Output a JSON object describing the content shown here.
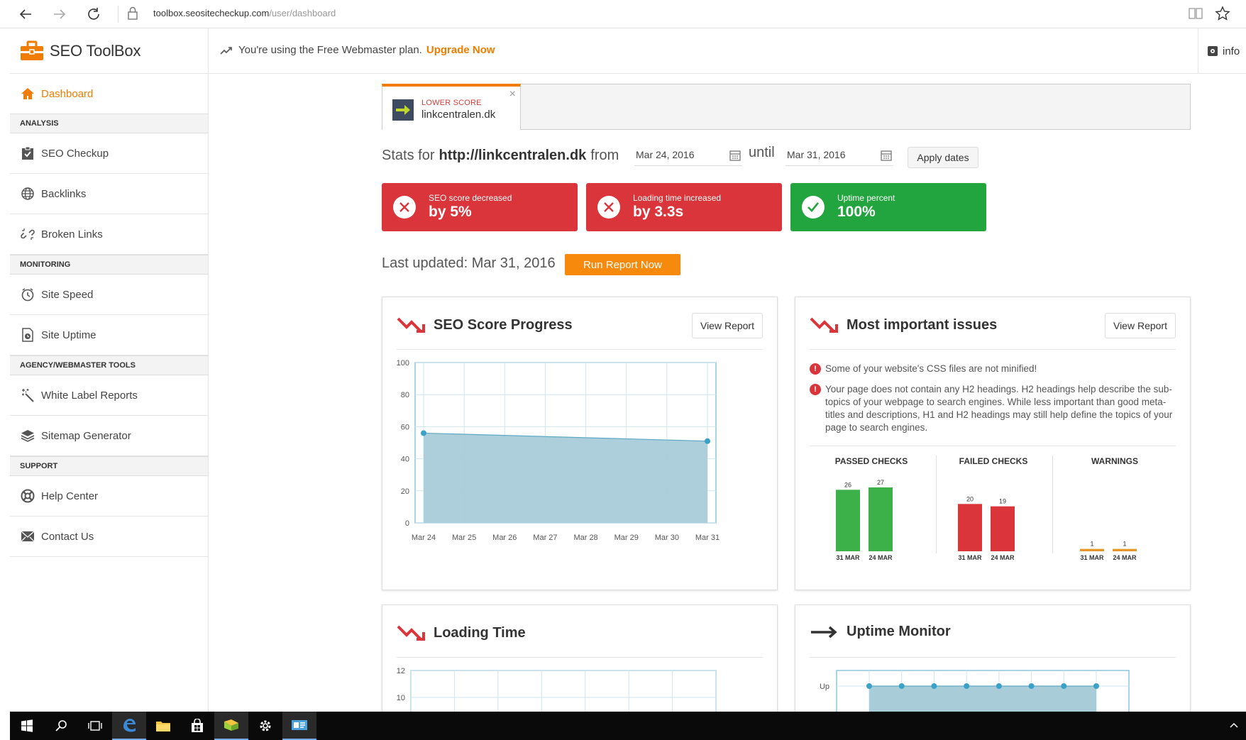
{
  "browser": {
    "url_host": "toolbox.seositecheckup.com",
    "url_path": "/user/dashboard"
  },
  "header": {
    "brand": "SEO ToolBox",
    "plan_text": "You're using the Free Webmaster plan.",
    "upgrade_label": "Upgrade Now",
    "info_label": "info"
  },
  "sidebar": {
    "dashboard": "Dashboard",
    "sections": {
      "analysis": "ANALYSIS",
      "monitoring": "MONITORING",
      "agency": "AGENCY/WEBMASTER TOOLS",
      "support": "SUPPORT"
    },
    "items": {
      "seo_checkup": "SEO Checkup",
      "backlinks": "Backlinks",
      "broken_links": "Broken Links",
      "site_speed": "Site Speed",
      "site_uptime": "Site Uptime",
      "white_label": "White Label Reports",
      "sitemap": "Sitemap Generator",
      "help": "Help Center",
      "contact": "Contact Us"
    }
  },
  "tab": {
    "status": "LOWER SCORE",
    "domain": "linkcentralen.dk",
    "close": "×"
  },
  "stats": {
    "prefix": "Stats for",
    "site": "http://linkcentralen.dk",
    "from": "from",
    "from_date": "Mar 24, 2016",
    "until": "until",
    "until_date": "Mar 31, 2016",
    "apply": "Apply dates"
  },
  "alerts": [
    {
      "small": "SEO score decreased",
      "big": "by 5%"
    },
    {
      "small": "Loading time increased",
      "big": "by 3.3s"
    },
    {
      "small": "Uptime percent",
      "big": "100%"
    }
  ],
  "last_updated": "Last updated: Mar 31, 2016",
  "run_report": "Run Report Now",
  "panels": {
    "seo_progress": {
      "title": "SEO Score Progress",
      "button": "View Report"
    },
    "issues": {
      "title": "Most important issues",
      "button": "View Report",
      "items": [
        "Some of your website's CSS files are not minified!",
        "Your page does not contain any H2 headings. H2 headings help describe the sub-topics of your webpage to search engines. While less important than good meta-titles and descriptions, H1 and H2 headings may still help define the topics of your page to search engines."
      ],
      "passed": "PASSED CHECKS",
      "failed": "FAILED CHECKS",
      "warnings": "WARNINGS",
      "issue_icon": "!"
    },
    "loading": {
      "title": "Loading Time"
    },
    "uptime": {
      "title": "Uptime Monitor"
    }
  },
  "chart_data": [
    {
      "type": "area",
      "x": [
        "Mar 24",
        "Mar 25",
        "Mar 26",
        "Mar 27",
        "Mar 28",
        "Mar 29",
        "Mar 30",
        "Mar 31"
      ],
      "series": [
        {
          "points": [
            [
              "Mar 24",
              56
            ],
            [
              "Mar 31",
              51
            ]
          ]
        }
      ],
      "ylim": [
        0,
        100
      ],
      "yticks": [
        0,
        20,
        40,
        60,
        80,
        100
      ],
      "grid": true,
      "color": "#a9ccd9"
    },
    {
      "type": "bar",
      "categories": [
        "31 MAR",
        "24 MAR"
      ],
      "series": [
        {
          "name": "PASSED CHECKS",
          "values": [
            26,
            27
          ]
        }
      ],
      "color": "#3cb14a"
    },
    {
      "type": "bar",
      "categories": [
        "31 MAR",
        "24 MAR"
      ],
      "series": [
        {
          "name": "FAILED CHECKS",
          "values": [
            20,
            19
          ]
        }
      ],
      "color": "#d9353a"
    },
    {
      "type": "bar",
      "categories": [
        "31 MAR",
        "24 MAR"
      ],
      "series": [
        {
          "name": "WARNINGS",
          "values": [
            1,
            1
          ]
        }
      ],
      "color": "#e8962a"
    },
    {
      "type": "line",
      "yticks": [
        10,
        12
      ],
      "grid": true
    },
    {
      "type": "area",
      "ytick": "Up",
      "points": 8,
      "grid": true,
      "color": "#a9ccd9"
    }
  ]
}
